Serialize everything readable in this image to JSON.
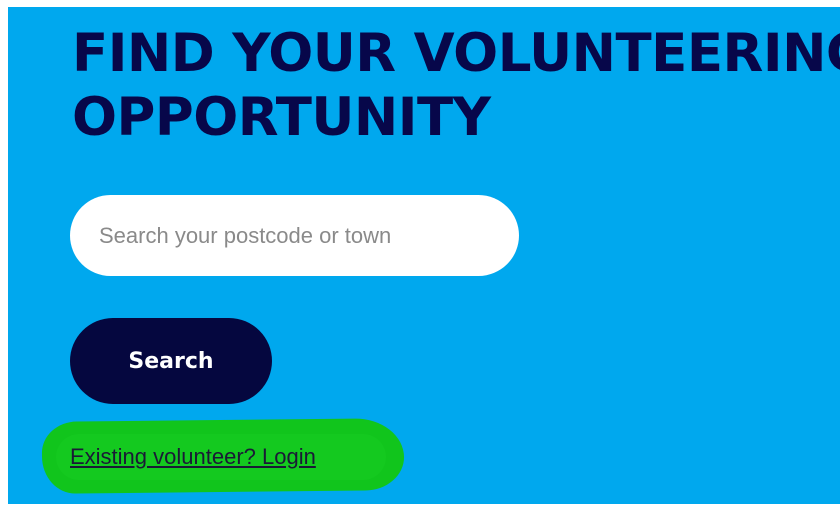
{
  "hero": {
    "headline_line1": "FIND YOUR VOLUNTEERING",
    "headline_line2": "OPPORTUNITY"
  },
  "search": {
    "placeholder": "Search your postcode or town",
    "value": "",
    "button_label": "Search"
  },
  "login": {
    "link_text": "Existing volunteer? Login"
  },
  "colors": {
    "panel_background": "#00a8ee",
    "headline": "#07074a",
    "button_background": "#05073f",
    "button_text": "#ffffff",
    "annotation_highlight": "#11c51c"
  }
}
